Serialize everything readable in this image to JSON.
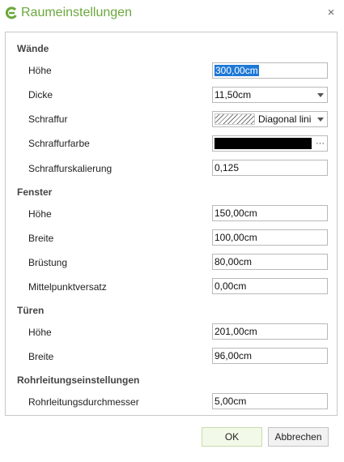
{
  "window": {
    "title": "Raumeinstellungen",
    "close_glyph": "×",
    "accent": "#6aa83c"
  },
  "walls": {
    "heading": "Wände",
    "height": {
      "label": "Höhe",
      "value": "300,00cm"
    },
    "thickness": {
      "label": "Dicke",
      "value": "11,50cm"
    },
    "hatch": {
      "label": "Schraffur",
      "value": "Diagonal linie"
    },
    "hatch_color": {
      "label": "Schraffurfarbe",
      "value_color": "#000000",
      "more": "···"
    },
    "hatch_scale": {
      "label": "Schraffurskalierung",
      "value": "0,125"
    }
  },
  "windows": {
    "heading": "Fenster",
    "height": {
      "label": "Höhe",
      "value": "150,00cm"
    },
    "width": {
      "label": "Breite",
      "value": "100,00cm"
    },
    "sill": {
      "label": "Brüstung",
      "value": "80,00cm"
    },
    "offset": {
      "label": "Mittelpunktversatz",
      "value": "0,00cm"
    }
  },
  "doors": {
    "heading": "Türen",
    "height": {
      "label": "Höhe",
      "value": "201,00cm"
    },
    "width": {
      "label": "Breite",
      "value": "96,00cm"
    }
  },
  "pipes": {
    "heading": "Rohrleitungseinstellungen",
    "diameter": {
      "label": "Rohrleitungsdurchmesser",
      "value": "5,00cm"
    }
  },
  "buttons": {
    "ok": "OK",
    "cancel": "Abbrechen"
  }
}
